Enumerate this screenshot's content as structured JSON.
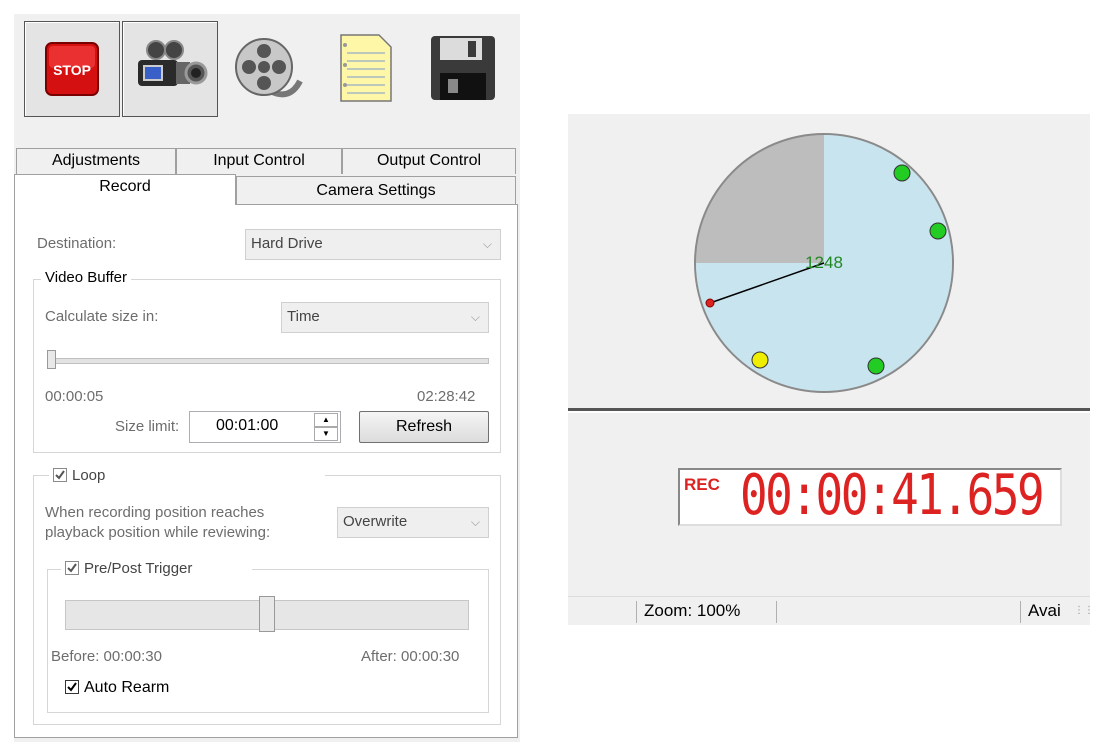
{
  "toolbar": {
    "stop_label": "STOP",
    "buttons": [
      {
        "icon": "stop-icon",
        "pressed": true
      },
      {
        "icon": "video-camera-icon",
        "pressed": true
      },
      {
        "icon": "film-reel-icon",
        "pressed": false
      },
      {
        "icon": "notes-icon",
        "pressed": false
      },
      {
        "icon": "floppy-disk-icon",
        "pressed": false
      }
    ]
  },
  "tabs": {
    "row1": [
      "Adjustments",
      "Input Control",
      "Output Control"
    ],
    "row2": [
      "Record",
      "Camera Settings"
    ],
    "active": "Record"
  },
  "record": {
    "destination_label": "Destination:",
    "destination_value": "Hard Drive",
    "video_buffer": {
      "title": "Video Buffer",
      "calc_label": "Calculate size in:",
      "calc_value": "Time",
      "slider_min": "00:00:05",
      "slider_max": "02:28:42",
      "slider_position": 0.0,
      "size_limit_label": "Size limit:",
      "size_limit_value": "00:01:00",
      "refresh_label": "Refresh"
    },
    "loop": {
      "title": "Loop",
      "checked": true,
      "text_line1": "When recording position reaches",
      "text_line2": "playback position while reviewing:",
      "mode_value": "Overwrite",
      "trigger": {
        "title": "Pre/Post Trigger",
        "checked": true,
        "slider_position": 0.5,
        "before": "Before: 00:00:30",
        "after": "After: 00:00:30",
        "auto_rearm_label": "Auto Rearm",
        "auto_rearm_checked": true
      }
    }
  },
  "clock": {
    "center_value": "1248",
    "filled_fraction": 0.75
  },
  "rec_display": {
    "tag": "REC",
    "time": "00:00:41.659"
  },
  "status_bar": {
    "zoom": "Zoom: 100%",
    "avail": "Avai"
  },
  "colors": {
    "fill": "#c8e4ef",
    "empty": "#bdbdbd",
    "marker_green": "#22cc22",
    "marker_yellow": "#eeee00",
    "rec_red": "#dd2222"
  }
}
